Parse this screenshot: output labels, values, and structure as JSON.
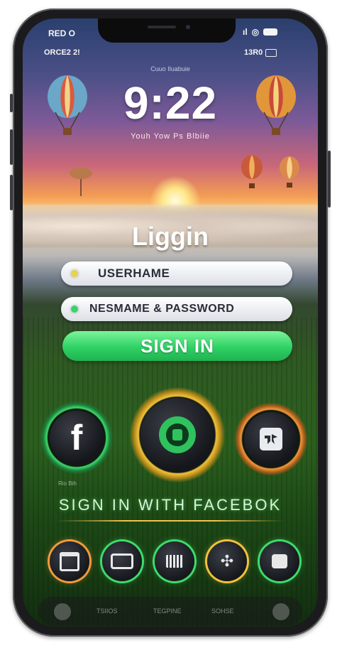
{
  "status": {
    "top_left": "RED O",
    "top_right_signal": "ıl",
    "row2_left": "ORCE2 2!",
    "row2_right": "13R0"
  },
  "lockscreen": {
    "time": "9:22",
    "caption": "Youh Yow Ps Blbiie",
    "date_small": "Cuuo Iluabuie"
  },
  "login": {
    "title": "Liggin",
    "username_placeholder": "USERHAME",
    "password_placeholder": "NESMAME & PASSWORD",
    "signin_label": "SIGN IN",
    "social_caption": "SIGN IN WITH FACEBOK",
    "social_left_icon": "facebook-icon",
    "social_center_icon": "camera-icon",
    "social_right_icon": "app-icon",
    "small_label": "Rio Bih"
  },
  "colors": {
    "accent_green": "#2ed164",
    "ring_green": "#3ddc6a",
    "ring_gold": "#f2c23a",
    "ring_orange": "#f39a3a",
    "username_dot": "#e8d34a",
    "password_dot": "#37d46a"
  },
  "dock": [
    {
      "icon": "window-icon",
      "ring": "#f39a3a"
    },
    {
      "icon": "tray-icon",
      "ring": "#3ddc6a"
    },
    {
      "icon": "calendar-icon",
      "ring": "#3ddc6a"
    },
    {
      "icon": "puzzle-icon",
      "ring": "#f2c23a"
    },
    {
      "icon": "grid-icon",
      "ring": "#3ddc6a"
    }
  ],
  "tabbar_labels": [
    "TSIIOS",
    "TEGPINE",
    "SOHSE"
  ]
}
